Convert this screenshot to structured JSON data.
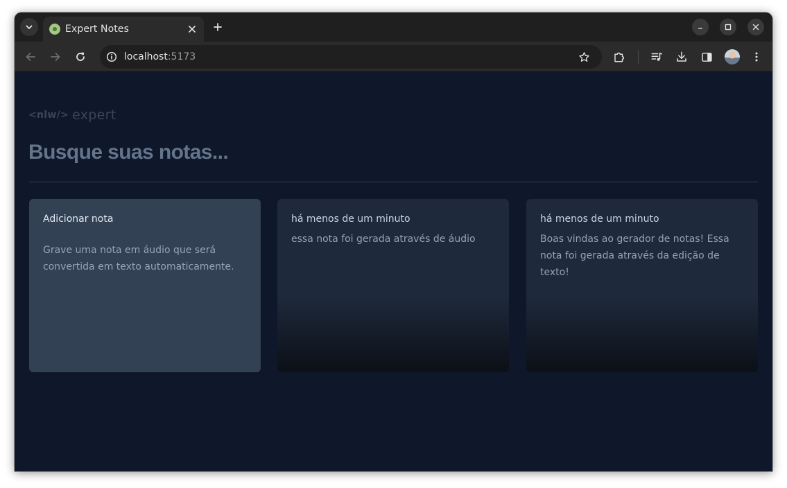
{
  "browser": {
    "tab_title": "Expert Notes",
    "url_host": "localhost",
    "url_port": ":5173"
  },
  "icons": {
    "tab_search": "chevron-down-icon",
    "close_tab": "close-icon",
    "new_tab": "plus-icon",
    "back": "arrow-left-icon",
    "forward": "arrow-right-icon",
    "reload": "reload-icon",
    "site_info": "info-icon",
    "bookmark": "star-icon",
    "extensions": "puzzle-icon",
    "media": "media-queue-icon",
    "downloads": "download-icon",
    "side_panel": "side-panel-icon",
    "menu": "kebab-menu-icon"
  },
  "app": {
    "logo_nlw": "<nlw/>",
    "logo_expert": "expert",
    "search_placeholder": "Busque suas notas..."
  },
  "add_card": {
    "title": "Adicionar nota",
    "text": "Grave uma nota em áudio que será convertida em texto automaticamente."
  },
  "notes": [
    {
      "date": "há menos de um minuto",
      "content": "essa nota foi gerada através de áudio"
    },
    {
      "date": "há menos de um minuto",
      "content": "Boas vindas ao gerador de notas! Essa nota foi gerada através da edição de texto!"
    }
  ],
  "colors": {
    "page_bg": "#0f172a",
    "add_card_bg": "#334155",
    "note_card_bg": "#1e293b",
    "divider": "#334155"
  }
}
